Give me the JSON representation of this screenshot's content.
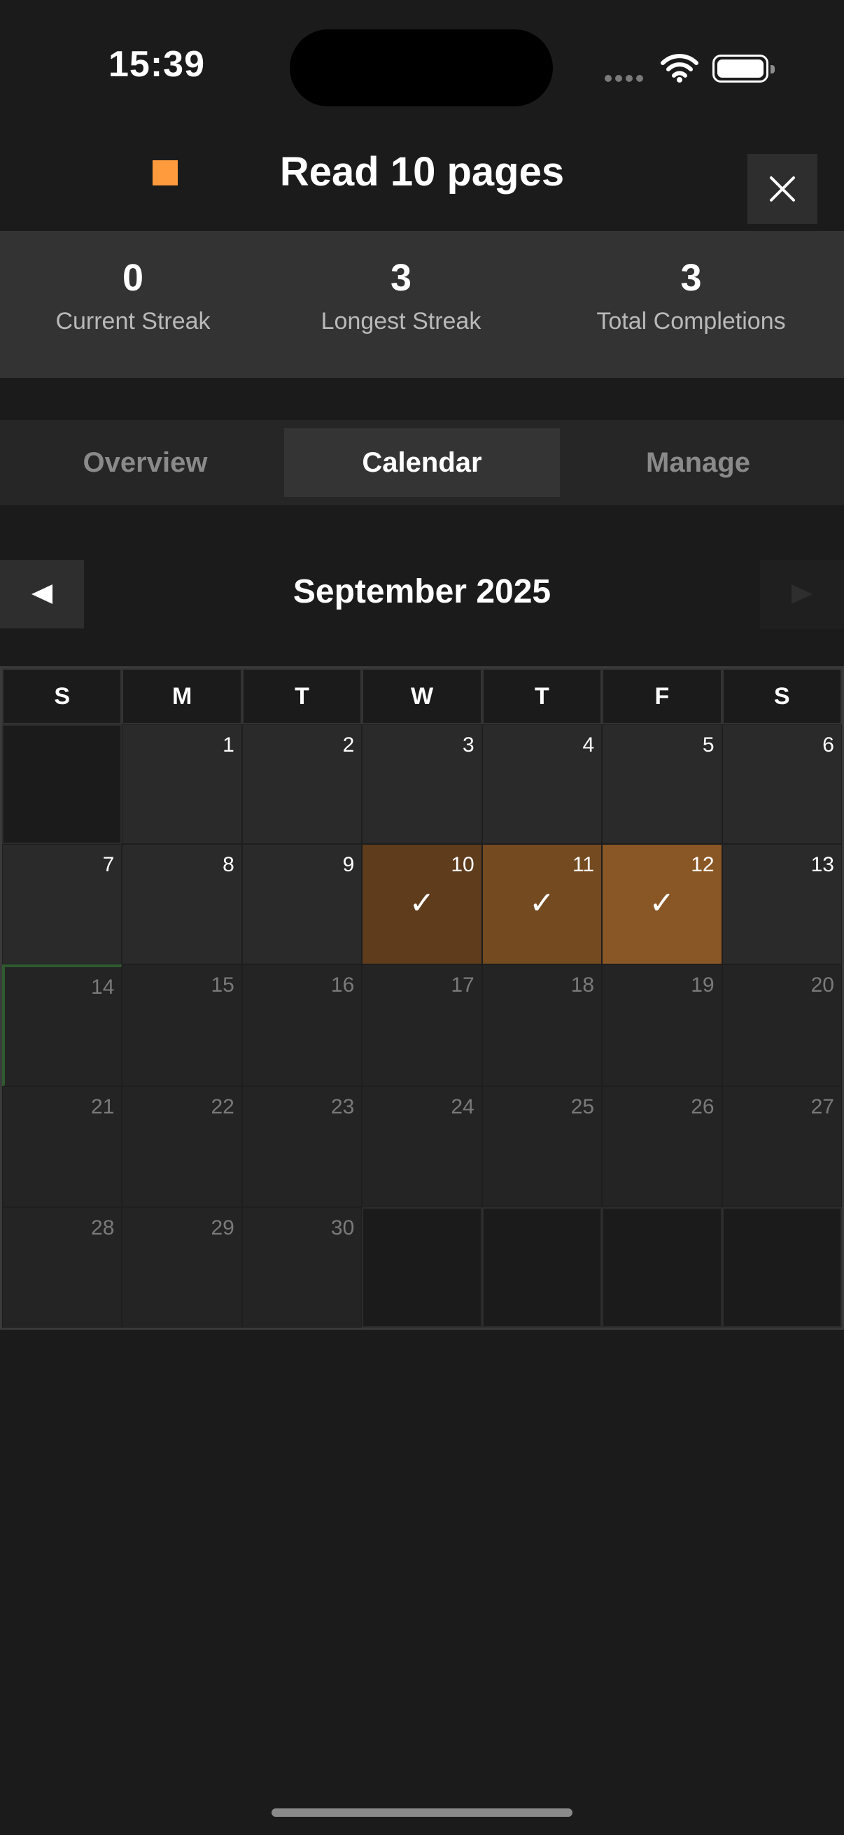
{
  "status_bar": {
    "time": "15:39"
  },
  "header": {
    "title": "Read 10 pages",
    "habit_color": "#ff9a3d"
  },
  "stats": [
    {
      "value": "0",
      "label": "Current Streak"
    },
    {
      "value": "3",
      "label": "Longest Streak"
    },
    {
      "value": "3",
      "label": "Total Completions"
    }
  ],
  "tabs": [
    {
      "label": "Overview",
      "active": false
    },
    {
      "label": "Calendar",
      "active": true
    },
    {
      "label": "Manage",
      "active": false
    }
  ],
  "calendar": {
    "month_label": "September 2025",
    "weekdays": [
      "S",
      "M",
      "T",
      "W",
      "T",
      "F",
      "S"
    ],
    "completed_days": [
      "10",
      "11",
      "12"
    ],
    "today": "14",
    "check_symbol": "✓",
    "completion_colors": [
      "#5e3c1c",
      "#744a21",
      "#895625"
    ],
    "weeks": [
      [
        "",
        "1",
        "2",
        "3",
        "4",
        "5",
        "6"
      ],
      [
        "7",
        "8",
        "9",
        "10",
        "11",
        "12",
        "13"
      ],
      [
        "14",
        "15",
        "16",
        "17",
        "18",
        "19",
        "20"
      ],
      [
        "21",
        "22",
        "23",
        "24",
        "25",
        "26",
        "27"
      ],
      [
        "28",
        "29",
        "30",
        "",
        "",
        "",
        ""
      ]
    ]
  }
}
